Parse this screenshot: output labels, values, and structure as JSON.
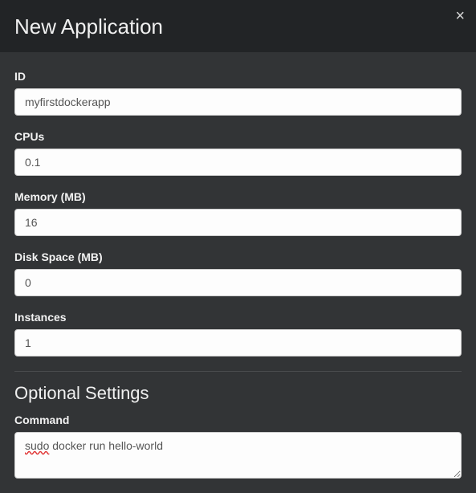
{
  "modal": {
    "title": "New Application"
  },
  "form": {
    "id": {
      "label": "ID",
      "value": "myfirstdockerapp"
    },
    "cpus": {
      "label": "CPUs",
      "value": "0.1"
    },
    "mem": {
      "label": "Memory (MB)",
      "value": "16"
    },
    "disk": {
      "label": "Disk Space (MB)",
      "value": "0"
    },
    "instances": {
      "label": "Instances",
      "value": "1"
    }
  },
  "optional": {
    "title": "Optional Settings",
    "command": {
      "label": "Command",
      "value_prefix": "sudo",
      "value_rest": " docker run hello-world"
    }
  }
}
